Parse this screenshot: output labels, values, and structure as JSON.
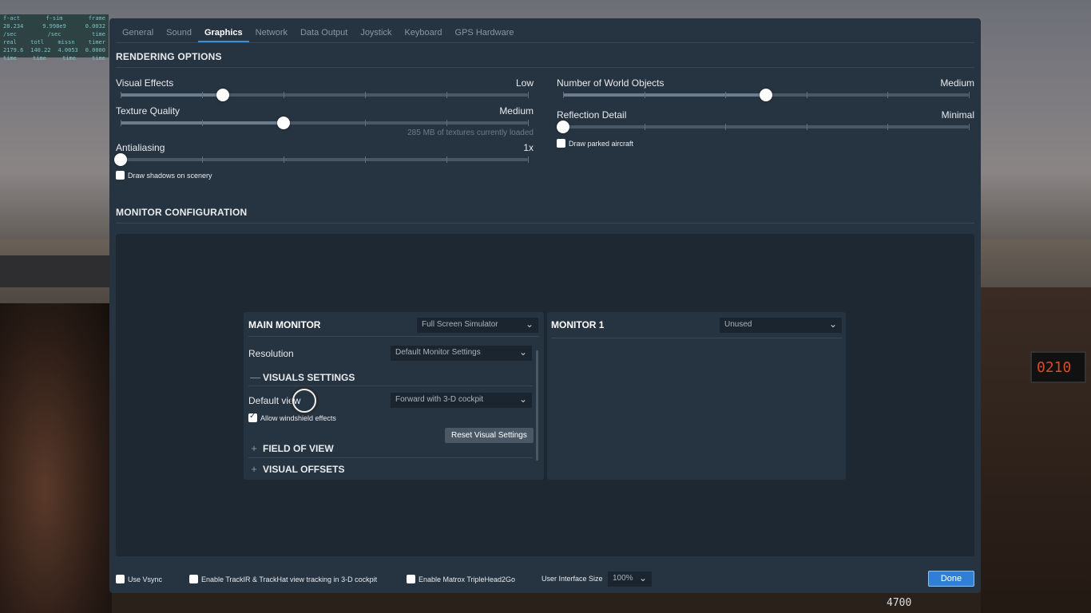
{
  "debug_overlay": {
    "rows": [
      [
        "f-act",
        "f-sim",
        "frame"
      ],
      [
        "28.234",
        "9.998e9",
        "0.0032"
      ],
      [
        "/sec",
        "/sec",
        "time"
      ],
      [
        "real",
        "totl",
        "missn",
        "timer"
      ],
      [
        "2179.6",
        "140.22",
        "4.0053",
        "0.0000"
      ],
      [
        "time",
        "time",
        "time",
        "time"
      ]
    ]
  },
  "background": {
    "clock": "0210",
    "altitude": "4700"
  },
  "tabs": [
    "General",
    "Sound",
    "Graphics",
    "Network",
    "Data Output",
    "Joystick",
    "Keyboard",
    "GPS Hardware"
  ],
  "active_tab": "Graphics",
  "rendering": {
    "title": "RENDERING OPTIONS",
    "visual_effects": {
      "label": "Visual Effects",
      "value": "Low",
      "level": 0.25
    },
    "texture_quality": {
      "label": "Texture Quality",
      "value": "Medium",
      "level": 0.4,
      "hint": "285 MB of textures currently loaded"
    },
    "antialiasing": {
      "label": "Antialiasing",
      "value": "1x",
      "level": 0.0
    },
    "draw_shadows": {
      "label": "Draw shadows on scenery",
      "checked": false
    },
    "world_objects": {
      "label": "Number of World Objects",
      "value": "Medium",
      "level": 0.5
    },
    "reflection_detail": {
      "label": "Reflection Detail",
      "value": "Minimal",
      "level": 0.0
    },
    "draw_parked": {
      "label": "Draw parked aircraft",
      "checked": false
    }
  },
  "monitor_config": {
    "title": "MONITOR CONFIGURATION",
    "main": {
      "title": "MAIN MONITOR",
      "mode": "Full Screen Simulator",
      "resolution_label": "Resolution",
      "resolution_value": "Default Monitor Settings",
      "visuals_settings": "VISUALS SETTINGS",
      "default_view_label": "Default view",
      "default_view_value": "Forward with 3-D cockpit",
      "windshield": {
        "label": "Allow windshield effects",
        "checked": true
      },
      "reset_button": "Reset Visual Settings",
      "field_of_view": "FIELD OF VIEW",
      "visual_offsets": "VISUAL OFFSETS",
      "collapse_symbol": "—",
      "expand_symbol": "+"
    },
    "monitor1": {
      "title": "MONITOR 1",
      "mode": "Unused"
    }
  },
  "footer": {
    "vsync": {
      "label": "Use Vsync",
      "checked": false
    },
    "trackir": {
      "label": "Enable TrackIR & TrackHat view tracking in 3-D cockpit",
      "checked": false
    },
    "matrox": {
      "label": "Enable Matrox TripleHead2Go",
      "checked": false
    },
    "ui_size_label": "User Interface Size",
    "ui_size_value": "100%",
    "done": "Done"
  }
}
